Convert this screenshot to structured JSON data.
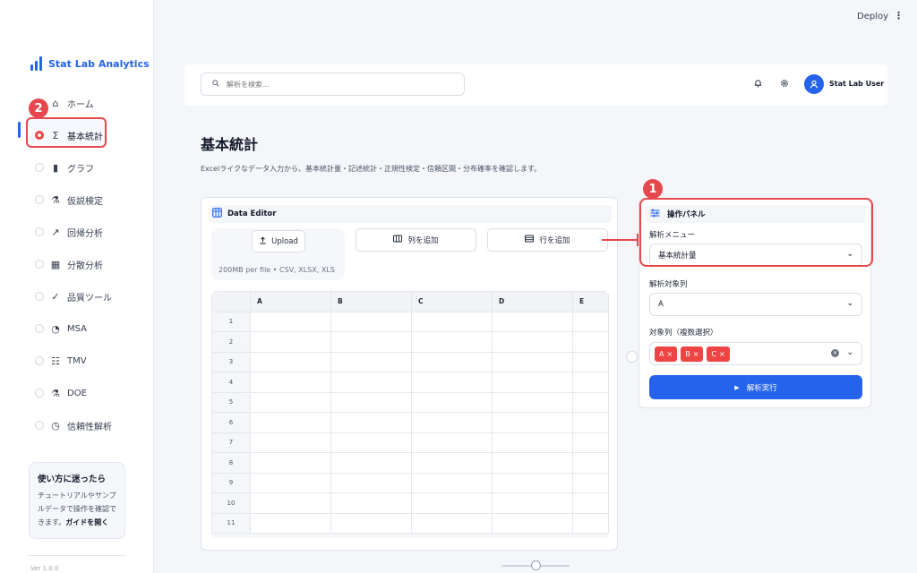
{
  "app": {
    "brand": "Stat Lab Analytics",
    "deploy_label": "Deploy",
    "kebab": "⋮",
    "version": "Ver 1.0.0"
  },
  "markers": {
    "one": "1",
    "two": "2"
  },
  "colors": {
    "accent": "#2563eb",
    "highlight": "#e5484d",
    "chip": "#ef4444"
  },
  "sidebar": {
    "items": [
      {
        "label": "ホーム",
        "icon": "home-icon",
        "glyph": "⌂",
        "active": false
      },
      {
        "label": "基本統計",
        "icon": "sigma-icon",
        "glyph": "Σ",
        "active": true
      },
      {
        "label": "グラフ",
        "icon": "bar-chart-icon",
        "glyph": "▮",
        "active": false
      },
      {
        "label": "仮説検定",
        "icon": "flask-icon",
        "glyph": "⚗",
        "active": false
      },
      {
        "label": "回帰分析",
        "icon": "trend-icon",
        "glyph": "↗",
        "active": false
      },
      {
        "label": "分散分析",
        "icon": "grid-icon",
        "glyph": "▦",
        "active": false
      },
      {
        "label": "品質ツール",
        "icon": "check-circle-icon",
        "glyph": "✓",
        "active": false
      },
      {
        "label": "MSA",
        "icon": "gauge-icon",
        "glyph": "◔",
        "active": false
      },
      {
        "label": "TMV",
        "icon": "sliders-icon",
        "glyph": "☷",
        "active": false
      },
      {
        "label": "DOE",
        "icon": "beaker-icon",
        "glyph": "⚗",
        "active": false
      },
      {
        "label": "信頼性解析",
        "icon": "clock-icon",
        "glyph": "◷",
        "active": false
      }
    ],
    "help": {
      "title": "使い方に迷ったら",
      "line1": "チュートリアルやサンプ",
      "line2": "ルデータで操作を確認で",
      "line3": "きます。",
      "link": "ガイドを開く"
    }
  },
  "header": {
    "search_placeholder": "解析を検索...",
    "user_name": "Stat Lab User"
  },
  "page": {
    "title": "基本統計",
    "description": "Excelライクなデータ入力から、基本統計量・記述統計・正規性検定・信頼区間・分布確率を確認します。"
  },
  "editor": {
    "title": "Data Editor",
    "upload_label": "Upload",
    "upload_hint": "200MB per file • CSV, XLSX, XLS",
    "add_column_label": "列を追加",
    "add_row_label": "行を追加",
    "columns": [
      "A",
      "B",
      "C",
      "D",
      "E"
    ],
    "rows": [
      "1",
      "2",
      "3",
      "4",
      "5",
      "6",
      "7",
      "8",
      "9",
      "10",
      "11"
    ]
  },
  "panel": {
    "title": "操作パネル",
    "menu_label": "解析メニュー",
    "menu_value": "基本統計量",
    "target_label": "解析対象列",
    "target_value": "A",
    "multi_label": "対象列（複数選択）",
    "chips": [
      "A",
      "B",
      "C"
    ],
    "run_label": "解析実行"
  }
}
